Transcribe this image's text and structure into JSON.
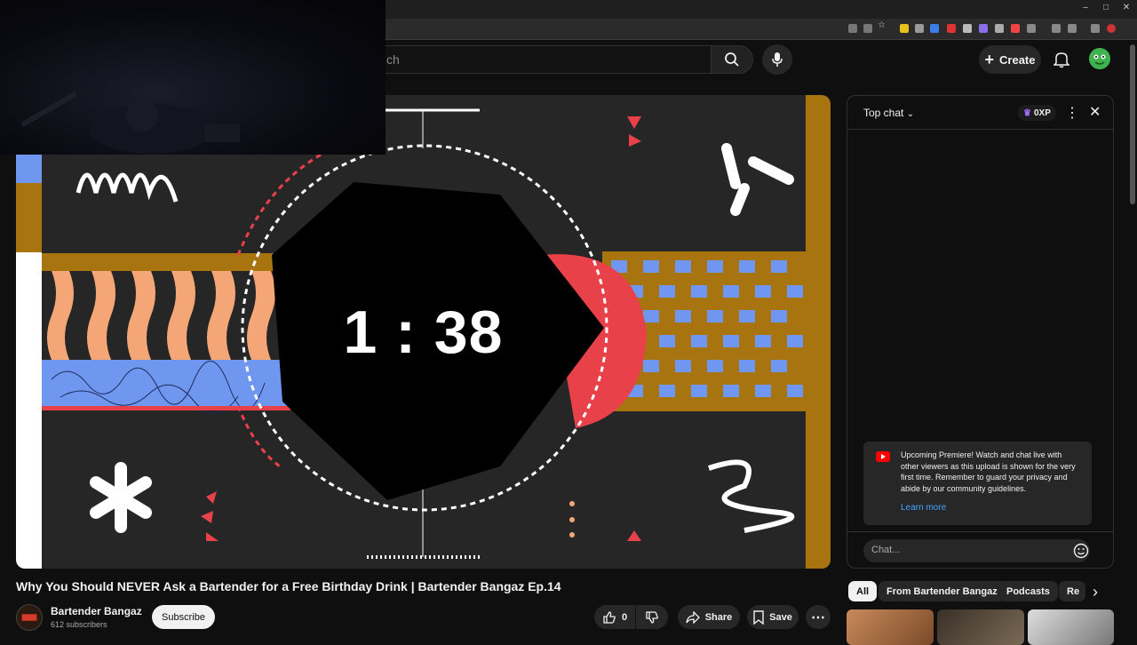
{
  "browser": {
    "colors": {
      "tabstrip": "#1f1f1f",
      "addressbar": "#2b2b2b"
    }
  },
  "header": {
    "search_placeholder": "ch",
    "create_label": "Create",
    "icons": [
      "search-icon",
      "mic-icon",
      "plus-icon",
      "bell-icon",
      "avatar"
    ]
  },
  "player": {
    "countdown": "1 : 38",
    "colors": {
      "background": "#262626",
      "gold": "#a8740f",
      "blue": "#6f97f0",
      "red": "#e84149",
      "peach": "#f5a677"
    }
  },
  "video": {
    "title": "Why You Should NEVER Ask a Bartender for a Free Birthday Drink | Bartender Bangaz Ep.14",
    "channel_name": "Bartender Bangaz",
    "subscribers": "612 subscribers",
    "subscribe_label": "Subscribe",
    "like_count": "0",
    "share_label": "Share",
    "save_label": "Save"
  },
  "chat": {
    "title": "Top chat",
    "xp_label": "0XP",
    "premiere_message": "Upcoming Premiere! Watch and chat live with other viewers as this upload is shown for the very first time. Remember to guard your privacy and abide by our community guidelines.",
    "learn_more": "Learn more",
    "input_placeholder": "Chat..."
  },
  "chips": {
    "items": [
      {
        "label": "All",
        "active": true
      },
      {
        "label": "From Bartender Bangaz",
        "active": false
      },
      {
        "label": "Podcasts",
        "active": false
      },
      {
        "label": "Re",
        "active": false
      }
    ]
  }
}
